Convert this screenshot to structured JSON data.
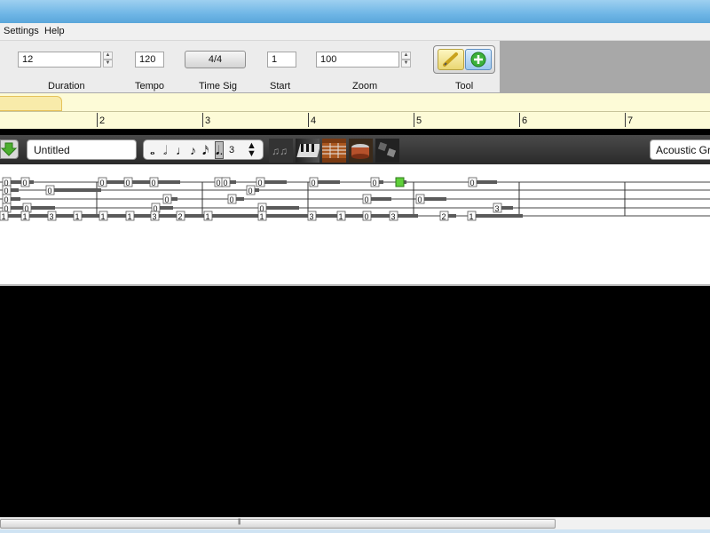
{
  "menu": {
    "items": [
      "Settings",
      "Help"
    ]
  },
  "toolbar": {
    "duration": {
      "label": "Duration",
      "value": "12"
    },
    "tempo": {
      "label": "Tempo",
      "value": "120"
    },
    "time_sig": {
      "label": "Time Sig",
      "value": "4/4"
    },
    "start": {
      "label": "Start",
      "value": "1"
    },
    "zoom": {
      "label": "Zoom",
      "value": "100"
    },
    "tool": {
      "label": "Tool",
      "items": [
        "pencil-tool",
        "add-tool"
      ]
    }
  },
  "timeline": {
    "measures": [
      "2",
      "3",
      "4",
      "5",
      "6",
      "7"
    ]
  },
  "track": {
    "name": "Untitled",
    "instrument": "Acoustic Gra",
    "note_values": [
      {
        "icon": "whole-note",
        "glyph": "𝅝"
      },
      {
        "icon": "half-note",
        "glyph": "𝅗𝅥"
      },
      {
        "icon": "quarter-note",
        "glyph": "♩"
      },
      {
        "icon": "eighth-note",
        "glyph": "♪"
      },
      {
        "icon": "sixteenth-note",
        "glyph": "𝅘𝅥𝅯"
      },
      {
        "icon": "dotted-note",
        "glyph": "𝅘𝅥."
      },
      {
        "icon": "triplet",
        "glyph": "3"
      }
    ],
    "selected_note_index": 5,
    "views": [
      "notation-view-icon",
      "piano-view-icon",
      "guitar-view-icon",
      "drum-view-icon",
      "more-view-icon"
    ]
  },
  "tablature": {
    "string_labels": [
      "0",
      "0",
      "0",
      "0",
      "0",
      "1"
    ],
    "notes": [
      {
        "string": 1,
        "fret": "0"
      },
      {
        "string": 1,
        "fret": "0"
      },
      {
        "string": 1,
        "fret": "0"
      },
      {
        "string": 1,
        "fret": "0"
      },
      {
        "string": 1,
        "fret": "0"
      },
      {
        "string": 1,
        "fret": "0"
      },
      {
        "string": 1,
        "fret": "0"
      },
      {
        "string": 1,
        "fret": "0"
      },
      {
        "string": 1,
        "fret": "0"
      },
      {
        "string": 1,
        "fret": "0"
      },
      {
        "string": 1,
        "fret": "0"
      },
      {
        "string": 1,
        "fret": "0"
      },
      {
        "string": 2,
        "fret": "0"
      },
      {
        "string": 2,
        "fret": "0"
      },
      {
        "string": 2,
        "fret": "0"
      },
      {
        "string": 3,
        "fret": "0"
      },
      {
        "string": 3,
        "fret": "0"
      },
      {
        "string": 3,
        "fret": "0"
      },
      {
        "string": 3,
        "fret": "0"
      },
      {
        "string": 3,
        "fret": "0"
      },
      {
        "string": 4,
        "fret": "0"
      },
      {
        "string": 4,
        "fret": "0"
      },
      {
        "string": 4,
        "fret": "0"
      },
      {
        "string": 4,
        "fret": "0"
      },
      {
        "string": 5,
        "fret": "1"
      },
      {
        "string": 5,
        "fret": "1"
      },
      {
        "string": 5,
        "fret": "3"
      },
      {
        "string": 5,
        "fret": "1"
      },
      {
        "string": 5,
        "fret": "1"
      },
      {
        "string": 5,
        "fret": "1"
      },
      {
        "string": 5,
        "fret": "3"
      },
      {
        "string": 5,
        "fret": "2"
      },
      {
        "string": 5,
        "fret": "1"
      },
      {
        "string": 5,
        "fret": "1"
      },
      {
        "string": 5,
        "fret": "3"
      },
      {
        "string": 5,
        "fret": "1"
      },
      {
        "string": 5,
        "fret": "0"
      },
      {
        "string": 5,
        "fret": "3"
      },
      {
        "string": 5,
        "fret": "2"
      },
      {
        "string": 5,
        "fret": "1"
      },
      {
        "string": 4,
        "fret": "3"
      }
    ],
    "highlight_color": "#5fcf3a"
  },
  "colors": {
    "timeline_bg": "#fdfbd7",
    "note_bar": "#5a5a5a"
  }
}
